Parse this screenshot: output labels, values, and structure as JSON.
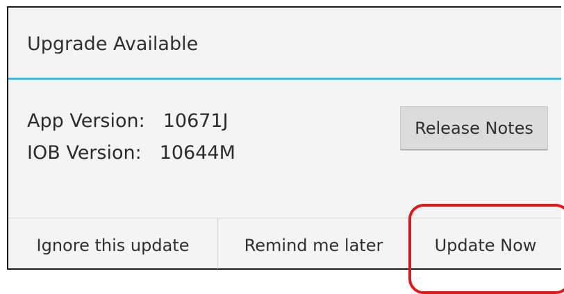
{
  "dialog": {
    "title": "Upgrade Available",
    "app_version_label": "App Version:",
    "app_version_value": "10671J",
    "iob_version_label": "IOB Version:",
    "iob_version_value": "10644M",
    "release_notes_label": "Release Notes"
  },
  "buttons": {
    "ignore_label": "Ignore this update",
    "remind_label": "Remind me later",
    "update_label": "Update Now"
  },
  "colors": {
    "title_divider": "#4ab4d6",
    "highlight": "#e3161b",
    "dialog_background": "#f4f4f4"
  }
}
